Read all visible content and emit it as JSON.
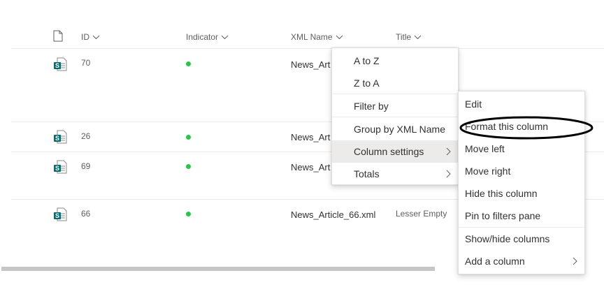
{
  "header": {
    "columns": {
      "id": "ID",
      "indicator": "Indicator",
      "xml_name": "XML Name",
      "title": "Title"
    }
  },
  "rows": [
    {
      "id": "70",
      "xml_name": "News_Art",
      "title": ""
    },
    {
      "id": "26",
      "xml_name": "News_Art",
      "title": ""
    },
    {
      "id": "69",
      "xml_name": "News_Art",
      "title": ""
    },
    {
      "id": "66",
      "xml_name": "News_Article_66.xml",
      "title": "Lesser Empty"
    }
  ],
  "colors": {
    "indicator_dot": "#2bc44a",
    "sharepoint_icon": "#036c70"
  },
  "column_menu": {
    "items": [
      {
        "label": "A to Z"
      },
      {
        "label": "Z to A"
      },
      {
        "label": "Filter by"
      },
      {
        "label": "Group by XML Name"
      },
      {
        "label": "Column settings"
      },
      {
        "label": "Totals"
      }
    ]
  },
  "column_settings_menu": {
    "items": [
      {
        "label": "Edit"
      },
      {
        "label": "Format this column"
      },
      {
        "label": "Move left"
      },
      {
        "label": "Move right"
      },
      {
        "label": "Hide this column"
      },
      {
        "label": "Pin to filters pane"
      },
      {
        "label": "Show/hide columns"
      },
      {
        "label": "Add a column"
      }
    ]
  }
}
